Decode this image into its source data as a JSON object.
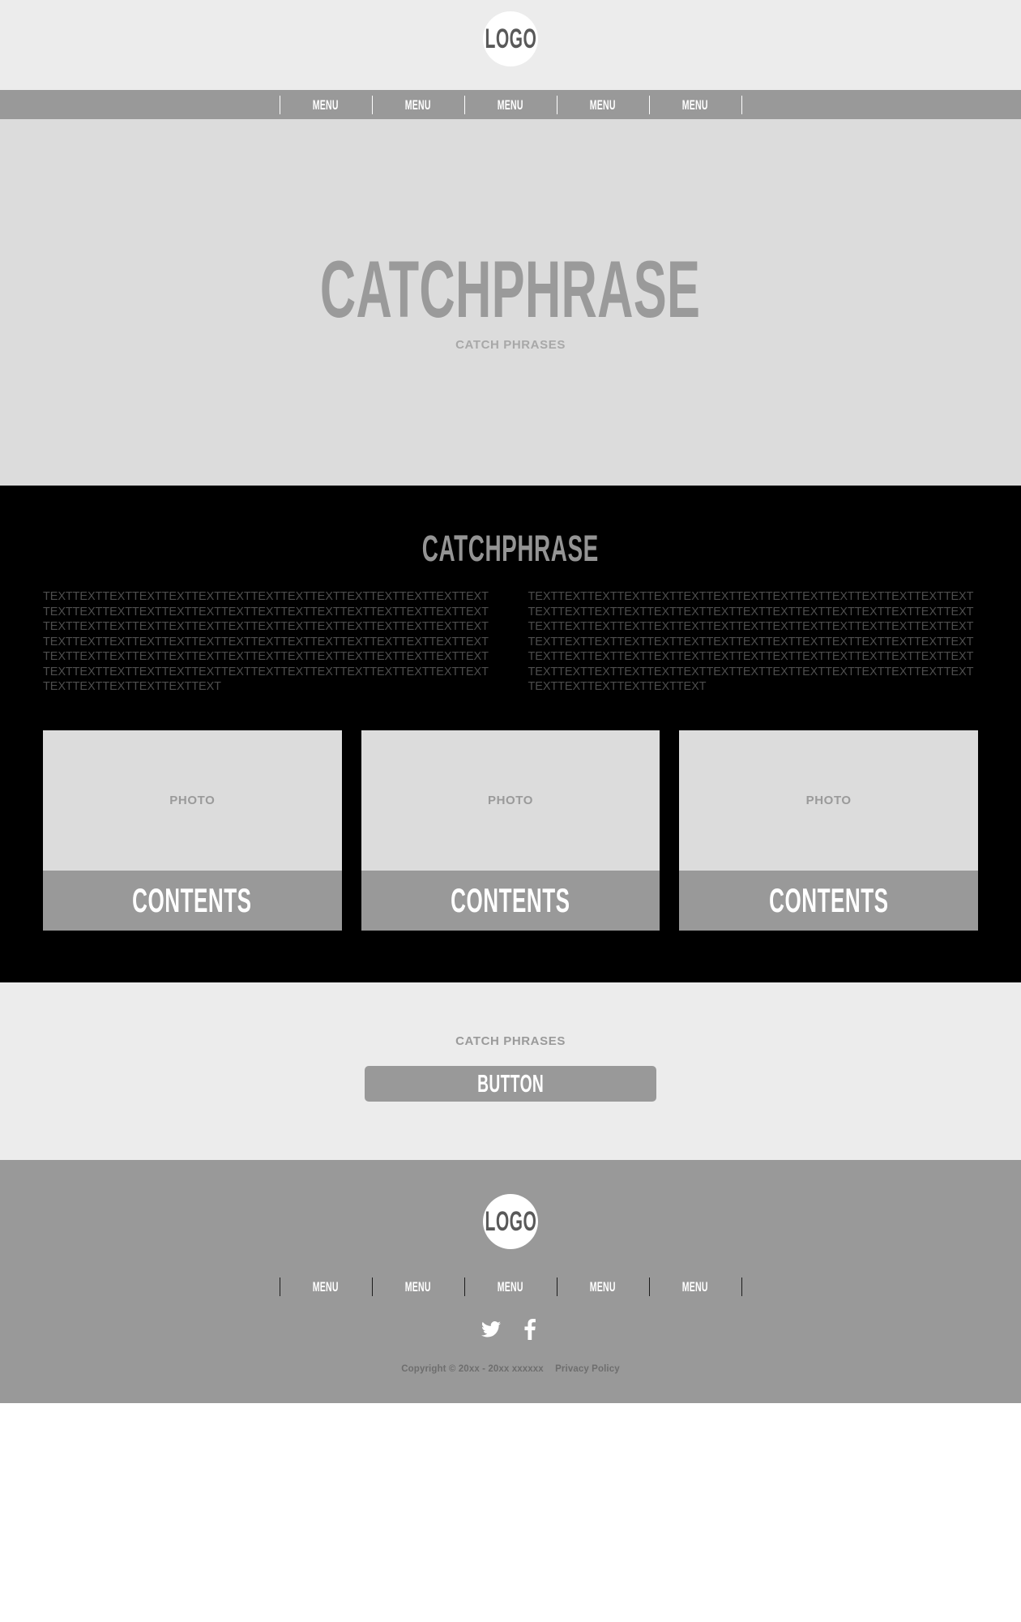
{
  "colors": {
    "header_bg": "#ececec",
    "nav_bg": "#999999",
    "hero_bg": "#dcdcdc",
    "dark_bg": "#000000",
    "cta_bg": "#ececec",
    "footer_bg": "#999999",
    "logo_bg": "#ffffff",
    "logo_text": "#595959",
    "hero_title": "#9a9a9a",
    "body_text": "#4d4d4d",
    "card_photo_bg": "#dcdcdc",
    "card_body_bg": "#999999",
    "button_bg": "#999999",
    "white": "#ffffff"
  },
  "header": {
    "logo_label": "LOGO"
  },
  "nav": {
    "items": [
      {
        "label": "MENU"
      },
      {
        "label": "MENU"
      },
      {
        "label": "MENU"
      },
      {
        "label": "MENU"
      },
      {
        "label": "MENU"
      }
    ]
  },
  "hero": {
    "title": "CATCHPHRASE",
    "subtitle": "CATCH PHRASES"
  },
  "dark_section": {
    "title": "CATCHPHRASE",
    "columns": [
      {
        "text": "TEXTTEXTTEXTTEXTTEXTTEXTTEXTTEXTTEXTTEXTTEXTTEXTTEXTTEXTTEXTTEXTTEXTTEXTTEXTTEXTTEXTTEXTTEXTTEXTTEXTTEXTTEXTTEXTTEXTTEXTTEXTTEXTTEXTTEXTTEXTTEXTTEXTTEXTTEXTTEXTTEXTTEXTTEXTTEXTTEXTTEXTTEXTTEXTTEXTTEXTTEXTTEXTTEXTTEXTTEXTTEXTTEXTTEXTTEXTTEXTTEXTTEXTTEXTTEXTTEXTTEXTTEXTTEXTTEXTTEXTTEXTTEXTTEXTTEXTTEXTTEXTTEXTTEXTTEXTTEXTTEXTTEXTTEXTTEXTTEXTTEXTTEXTTEXTTEXTTEXTTEXTTEXTTEXTTEXTTEXTTEXT"
      },
      {
        "text": "TEXTTEXTTEXTTEXTTEXTTEXTTEXTTEXTTEXTTEXTTEXTTEXTTEXTTEXTTEXTTEXTTEXTTEXTTEXTTEXTTEXTTEXTTEXTTEXTTEXTTEXTTEXTTEXTTEXTTEXTTEXTTEXTTEXTTEXTTEXTTEXTTEXTTEXTTEXTTEXTTEXTTEXTTEXTTEXTTEXTTEXTTEXTTEXTTEXTTEXTTEXTTEXTTEXTTEXTTEXTTEXTTEXTTEXTTEXTTEXTTEXTTEXTTEXTTEXTTEXTTEXTTEXTTEXTTEXTTEXTTEXTTEXTTEXTTEXTTEXTTEXTTEXTTEXTTEXTTEXTTEXTTEXTTEXTTEXTTEXTTEXTTEXTTEXTTEXTTEXTTEXTTEXTTEXTTEXTTEXTTEXT"
      }
    ],
    "cards": [
      {
        "photo_label": "PHOTO",
        "title": "CONTENTS"
      },
      {
        "photo_label": "PHOTO",
        "title": "CONTENTS"
      },
      {
        "photo_label": "PHOTO",
        "title": "CONTENTS"
      }
    ]
  },
  "cta": {
    "label": "CATCH PHRASES",
    "button_label": "BUTTON"
  },
  "footer": {
    "logo_label": "LOGO",
    "nav": {
      "items": [
        {
          "label": "MENU"
        },
        {
          "label": "MENU"
        },
        {
          "label": "MENU"
        },
        {
          "label": "MENU"
        },
        {
          "label": "MENU"
        }
      ]
    },
    "socials": [
      {
        "name": "twitter-icon"
      },
      {
        "name": "facebook-icon"
      }
    ],
    "copyright": "Copyright © 20xx - 20xx xxxxxx",
    "privacy": "Privacy Policy"
  }
}
